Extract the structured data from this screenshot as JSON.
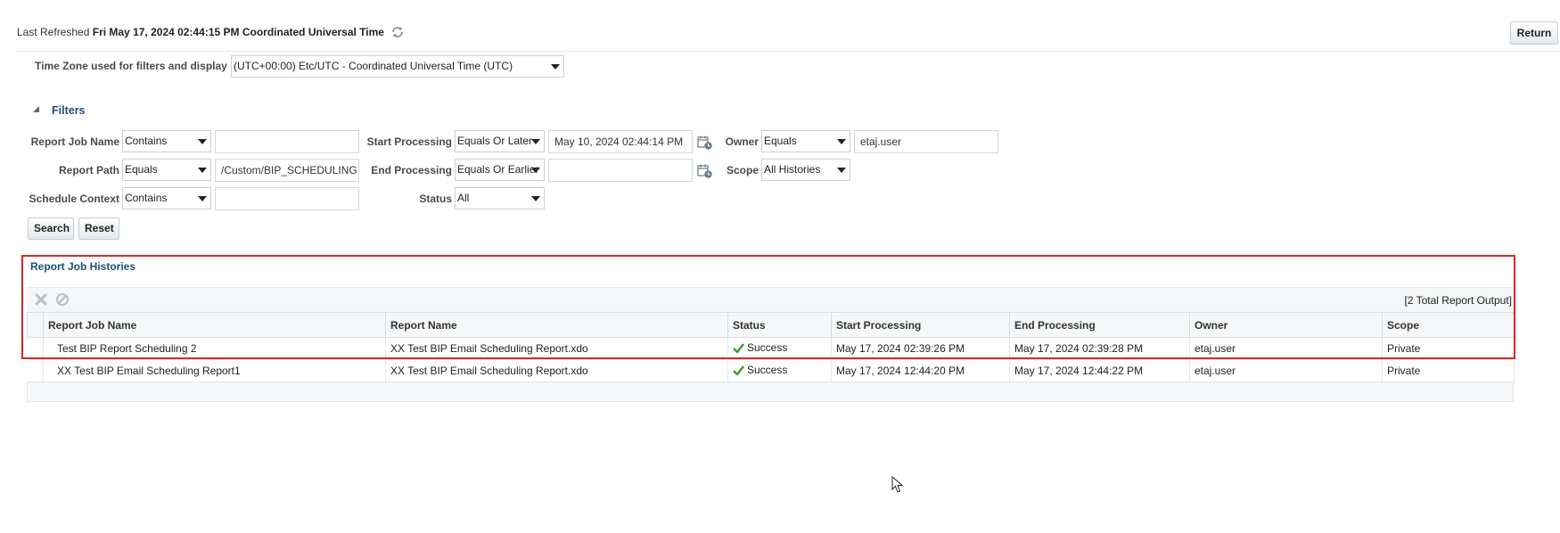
{
  "header": {
    "last_refreshed_label": "Last Refreshed",
    "last_refreshed_value": "Fri May 17, 2024 02:44:15 PM Coordinated Universal Time",
    "return_label": "Return"
  },
  "timezone": {
    "label": "Time Zone used for filters and display",
    "value": "(UTC+00:00) Etc/UTC - Coordinated Universal Time (UTC)"
  },
  "filters": {
    "title": "Filters",
    "report_job_name": {
      "label": "Report Job Name",
      "operator": "Contains",
      "value": ""
    },
    "report_path": {
      "label": "Report Path",
      "operator": "Equals",
      "value": "/Custom/BIP_SCHEDULING"
    },
    "schedule_context": {
      "label": "Schedule Context",
      "operator": "Contains",
      "value": ""
    },
    "start_processing": {
      "label": "Start Processing",
      "operator": "Equals Or Later",
      "value": "May 10, 2024 02:44:14 PM"
    },
    "end_processing": {
      "label": "End Processing",
      "operator": "Equals Or Earlier",
      "value": ""
    },
    "status": {
      "label": "Status",
      "value": "All"
    },
    "owner": {
      "label": "Owner",
      "operator": "Equals",
      "value": "etaj.user"
    },
    "scope": {
      "label": "Scope",
      "value": "All Histories"
    },
    "search_label": "Search",
    "reset_label": "Reset"
  },
  "results": {
    "title": "Report Job Histories",
    "total_label": "[2 Total Report Output]",
    "columns": [
      "Report Job Name",
      "Report Name",
      "Status",
      "Start Processing",
      "End Processing",
      "Owner",
      "Scope"
    ],
    "rows": [
      {
        "job_name": "Test BIP Report Scheduling 2",
        "report_name": "XX Test BIP Email Scheduling Report.xdo",
        "status": "Success",
        "start": "May 17, 2024 02:39:26 PM",
        "end": "May 17, 2024 02:39:28 PM",
        "owner": "etaj.user",
        "scope": "Private"
      },
      {
        "job_name": "XX Test BIP Email Scheduling Report1",
        "report_name": "XX Test BIP Email Scheduling Report.xdo",
        "status": "Success",
        "start": "May 17, 2024 12:44:20 PM",
        "end": "May 17, 2024 12:44:22 PM",
        "owner": "etaj.user",
        "scope": "Private"
      }
    ]
  },
  "icons": {
    "refresh": "refresh-icon",
    "calendar": "calendar-icon",
    "delete": "delete-icon",
    "cancel": "cancel-icon",
    "success": "checkmark-icon",
    "collapse": "triangle-down-icon"
  },
  "colors": {
    "link_blue": "#1f4e79",
    "highlight_red": "#d9262c",
    "success_green": "#3a9b2f"
  }
}
